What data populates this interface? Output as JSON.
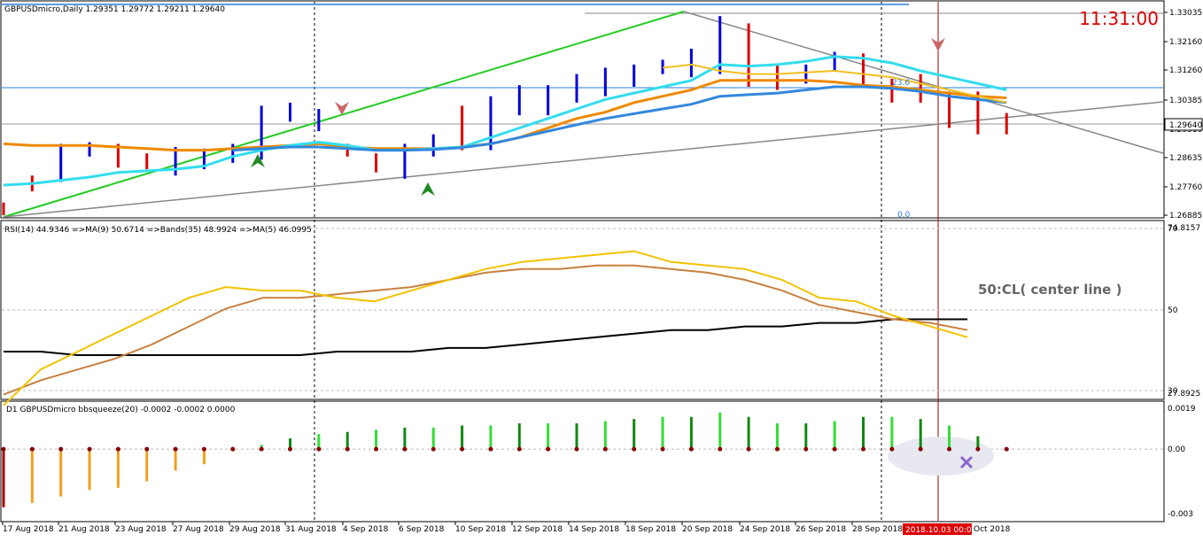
{
  "header": {
    "symbol_line": "GBPUSDmicro,Daily  1.29351 1.29772 1.29211 1.29640",
    "clock": "11:31:00"
  },
  "colors": {
    "bull": "#0000dd",
    "bear": "#dd0000",
    "ma_fast": "#33ddee",
    "ma_slow": "#3388dd",
    "ma_orange": "#ee8a00",
    "ma_yellow": "#f0c020",
    "trend_green": "#22cc22",
    "trend_gray": "#888888",
    "rsi_yellow": "#f2c200",
    "rsi_brown": "#c88040",
    "rsi_black": "#000000",
    "sq_green_dark": "#118811",
    "sq_green_light": "#33dd33",
    "sq_orange": "#f0a020",
    "sq_darkred": "#aa0000",
    "clock": "#dd0000"
  },
  "price_axis": {
    "ticks": [
      "1.33035",
      "1.32160",
      "1.31260",
      "1.30385",
      "1.29510",
      "1.28635",
      "1.27760",
      "1.26885"
    ],
    "current": "1.29640"
  },
  "fib": {
    "level_236": "23.6",
    "level_0": "0.0"
  },
  "rsi": {
    "label": "RSI(14) 44.9346  =>MA(9) 50.6714  =>Bands(35) 48.9924  =>MA(5) 46.0995",
    "ticks": [
      "74.8157",
      "70",
      "50",
      "30",
      "27.8925"
    ],
    "annotation": "50:CL( center line )"
  },
  "squeeze": {
    "label": "D1 GBPUSDmicro bbsqueeze(20) -0.0002 -0.0002 0.0000",
    "ticks": [
      "0.0019",
      "0.00",
      "-0.003"
    ]
  },
  "time_axis": {
    "labels": [
      "17 Aug 2018",
      "21 Aug 2018",
      "23 Aug 2018",
      "27 Aug 2018",
      "29 Aug 2018",
      "31 Aug 2018",
      "4 Sep 2018",
      "6 Sep 2018",
      "10 Sep 2018",
      "12 Sep 2018",
      "14 Sep 2018",
      "18 Sep 2018",
      "20 Sep 2018",
      "24 Sep 2018",
      "26 Sep 2018",
      "28 Sep 2018"
    ],
    "highlight": "2018.10.03 00:00",
    "tail": "Oct 2018"
  },
  "chart_data": {
    "type": "ohlc",
    "title": "GBPUSDmicro,Daily",
    "bars": [
      {
        "o": 1.2705,
        "h": 1.2715,
        "l": 1.2675,
        "c": 1.269
      },
      {
        "o": 1.279,
        "h": 1.28,
        "l": 1.275,
        "c": 1.276
      },
      {
        "o": 1.28,
        "h": 1.29,
        "l": 1.278,
        "c": 1.289
      },
      {
        "o": 1.288,
        "h": 1.2905,
        "l": 1.286,
        "c": 1.2895
      },
      {
        "o": 1.289,
        "h": 1.29,
        "l": 1.2825,
        "c": 1.284
      },
      {
        "o": 1.285,
        "h": 1.287,
        "l": 1.282,
        "c": 1.283
      },
      {
        "o": 1.283,
        "h": 1.289,
        "l": 1.28,
        "c": 1.288
      },
      {
        "o": 1.284,
        "h": 1.2885,
        "l": 1.282,
        "c": 1.2875
      },
      {
        "o": 1.286,
        "h": 1.29,
        "l": 1.284,
        "c": 1.289
      },
      {
        "o": 1.288,
        "h": 1.302,
        "l": 1.285,
        "c": 1.301
      },
      {
        "o": 1.299,
        "h": 1.303,
        "l": 1.297,
        "c": 1.302
      },
      {
        "o": 1.296,
        "h": 1.301,
        "l": 1.294,
        "c": 1.3
      },
      {
        "o": 1.288,
        "h": 1.29,
        "l": 1.286,
        "c": 1.287
      },
      {
        "o": 1.286,
        "h": 1.287,
        "l": 1.281,
        "c": 1.282
      },
      {
        "o": 1.282,
        "h": 1.29,
        "l": 1.279,
        "c": 1.289
      },
      {
        "o": 1.287,
        "h": 1.293,
        "l": 1.286,
        "c": 1.292
      },
      {
        "o": 1.301,
        "h": 1.302,
        "l": 1.288,
        "c": 1.2895
      },
      {
        "o": 1.29,
        "h": 1.305,
        "l": 1.288,
        "c": 1.304
      },
      {
        "o": 1.3,
        "h": 1.3085,
        "l": 1.299,
        "c": 1.308
      },
      {
        "o": 1.3,
        "h": 1.3085,
        "l": 1.299,
        "c": 1.308
      },
      {
        "o": 1.304,
        "h": 1.312,
        "l": 1.303,
        "c": 1.311
      },
      {
        "o": 1.306,
        "h": 1.314,
        "l": 1.305,
        "c": 1.313
      },
      {
        "o": 1.31,
        "h": 1.315,
        "l": 1.308,
        "c": 1.314
      },
      {
        "o": 1.314,
        "h": 1.3165,
        "l": 1.312,
        "c": 1.316
      },
      {
        "o": 1.313,
        "h": 1.32,
        "l": 1.311,
        "c": 1.319
      },
      {
        "o": 1.313,
        "h": 1.3303,
        "l": 1.312,
        "c": 1.3295
      },
      {
        "o": 1.327,
        "h": 1.328,
        "l": 1.308,
        "c": 1.309
      },
      {
        "o": 1.314,
        "h": 1.315,
        "l": 1.307,
        "c": 1.308
      },
      {
        "o": 1.312,
        "h": 1.315,
        "l": 1.309,
        "c": 1.314
      },
      {
        "o": 1.315,
        "h": 1.319,
        "l": 1.313,
        "c": 1.318
      },
      {
        "o": 1.318,
        "h": 1.3185,
        "l": 1.308,
        "c": 1.309
      },
      {
        "o": 1.31,
        "h": 1.3105,
        "l": 1.303,
        "c": 1.304
      },
      {
        "o": 1.311,
        "h": 1.312,
        "l": 1.303,
        "c": 1.305
      },
      {
        "o": 1.306,
        "h": 1.3065,
        "l": 1.295,
        "c": 1.296
      },
      {
        "o": 1.306,
        "h": 1.3065,
        "l": 1.293,
        "c": 1.294
      },
      {
        "o": 1.299,
        "h": 1.2997,
        "l": 1.293,
        "c": 1.2964
      }
    ],
    "ma_fast": [
      1.277,
      1.2775,
      1.2785,
      1.2795,
      1.281,
      1.2815,
      1.282,
      1.283,
      1.286,
      1.288,
      1.2895,
      1.2905,
      1.2895,
      1.288,
      1.288,
      1.2885,
      1.289,
      1.292,
      1.295,
      1.298,
      1.301,
      1.304,
      1.306,
      1.308,
      1.31,
      1.315,
      1.3145,
      1.315,
      1.316,
      1.3175,
      1.317,
      1.3155,
      1.313,
      1.311,
      1.309,
      1.307
    ],
    "ma_slow": [
      null,
      null,
      null,
      null,
      null,
      null,
      null,
      null,
      1.288,
      1.2885,
      1.289,
      1.289,
      1.2885,
      1.288,
      1.288,
      1.2882,
      1.2888,
      1.29,
      1.292,
      1.294,
      1.296,
      1.298,
      1.2995,
      1.301,
      1.3025,
      1.305,
      1.3055,
      1.306,
      1.307,
      1.308,
      1.308,
      1.3075,
      1.3065,
      1.305,
      1.304,
      1.303
    ],
    "ma_orange": [
      1.29,
      1.2895,
      1.2895,
      1.2895,
      1.289,
      1.2885,
      1.288,
      1.288,
      1.2885,
      1.289,
      1.2895,
      1.29,
      1.289,
      1.2885,
      1.2885,
      1.2885,
      1.289,
      1.29,
      1.292,
      1.295,
      1.298,
      1.3,
      1.303,
      1.305,
      1.307,
      1.31,
      1.31,
      1.31,
      1.31,
      1.3095,
      1.3085,
      1.308,
      1.307,
      1.306,
      1.305,
      1.3045
    ],
    "ma_yellow": [
      null,
      null,
      null,
      null,
      null,
      null,
      null,
      null,
      null,
      null,
      null,
      null,
      null,
      null,
      null,
      null,
      null,
      null,
      null,
      null,
      null,
      null,
      null,
      1.314,
      1.315,
      1.313,
      1.312,
      1.312,
      1.3125,
      1.313,
      1.312,
      1.311,
      1.309,
      1.307,
      1.305,
      1.303
    ],
    "rsi": [
      25,
      35,
      40,
      45,
      50,
      55,
      58,
      57,
      57,
      55,
      54,
      57,
      60,
      63,
      65,
      66,
      67,
      68,
      65,
      64,
      63,
      60,
      55,
      54,
      50,
      47,
      44
    ],
    "rsi_ma": [
      28,
      32,
      35,
      38,
      42,
      47,
      52,
      55,
      55,
      56,
      57,
      58,
      60,
      62,
      63,
      63,
      64,
      64,
      63,
      62,
      60,
      57,
      53,
      51,
      49,
      48,
      46
    ],
    "rsi_bands": [
      40,
      40,
      39,
      39,
      39,
      39,
      39,
      39,
      39,
      40,
      40,
      40,
      41,
      41,
      42,
      43,
      44,
      45,
      46,
      46,
      47,
      47,
      48,
      48,
      49,
      49,
      49
    ],
    "squeeze": [
      -0.0027,
      -0.0025,
      -0.0022,
      -0.0019,
      -0.0018,
      -0.0015,
      -0.001,
      -0.0007,
      -0.0001,
      0.0002,
      0.0005,
      0.0007,
      0.0008,
      0.0009,
      0.001,
      0.001,
      0.0011,
      0.0011,
      0.0012,
      0.0012,
      0.0012,
      0.0013,
      0.0014,
      0.0015,
      0.0015,
      0.0017,
      0.0015,
      0.0012,
      0.0012,
      0.0013,
      0.0015,
      0.0015,
      0.0014,
      0.0011,
      0.0006,
      0.0
    ],
    "price_range": [
      1.2675,
      1.332
    ],
    "rsi_range": [
      27.8925,
      74.8157
    ],
    "squeeze_range": [
      -0.003,
      0.0019
    ]
  }
}
